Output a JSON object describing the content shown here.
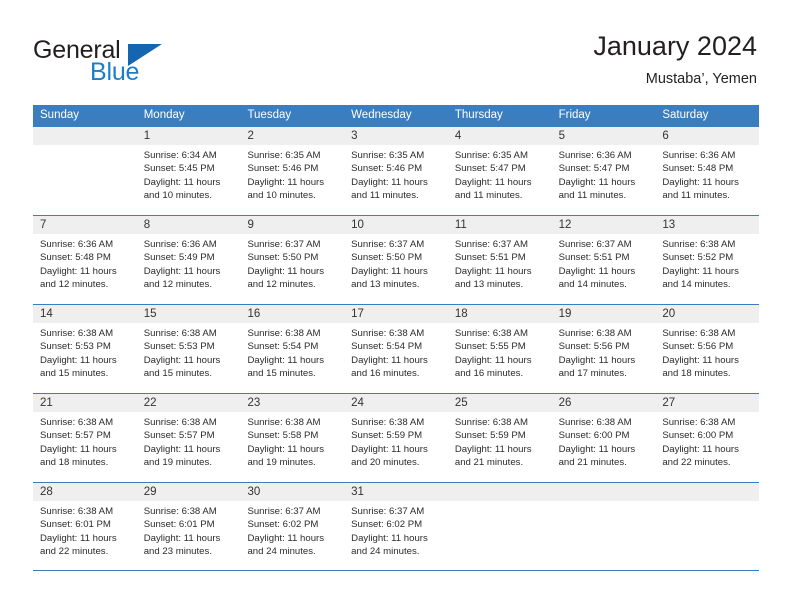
{
  "brand": {
    "name_part1": "General",
    "name_part2": "Blue",
    "triangle_color": "#1566b0",
    "blue_color": "#1a7ec8"
  },
  "header": {
    "title": "January 2024",
    "subtitle": "Mustaba’, Yemen"
  },
  "theme": {
    "header_blue": "#3a7ec0",
    "band_gray": "#efefef",
    "text": "#231f20"
  },
  "weekdays": [
    "Sunday",
    "Monday",
    "Tuesday",
    "Wednesday",
    "Thursday",
    "Friday",
    "Saturday"
  ],
  "weeks": [
    [
      {
        "day": "",
        "sunrise": "",
        "sunset": "",
        "daylight": "",
        "daylight2": ""
      },
      {
        "day": "1",
        "sunrise": "Sunrise: 6:34 AM",
        "sunset": "Sunset: 5:45 PM",
        "daylight": "Daylight: 11 hours",
        "daylight2": "and 10 minutes."
      },
      {
        "day": "2",
        "sunrise": "Sunrise: 6:35 AM",
        "sunset": "Sunset: 5:46 PM",
        "daylight": "Daylight: 11 hours",
        "daylight2": "and 10 minutes."
      },
      {
        "day": "3",
        "sunrise": "Sunrise: 6:35 AM",
        "sunset": "Sunset: 5:46 PM",
        "daylight": "Daylight: 11 hours",
        "daylight2": "and 11 minutes."
      },
      {
        "day": "4",
        "sunrise": "Sunrise: 6:35 AM",
        "sunset": "Sunset: 5:47 PM",
        "daylight": "Daylight: 11 hours",
        "daylight2": "and 11 minutes."
      },
      {
        "day": "5",
        "sunrise": "Sunrise: 6:36 AM",
        "sunset": "Sunset: 5:47 PM",
        "daylight": "Daylight: 11 hours",
        "daylight2": "and 11 minutes."
      },
      {
        "day": "6",
        "sunrise": "Sunrise: 6:36 AM",
        "sunset": "Sunset: 5:48 PM",
        "daylight": "Daylight: 11 hours",
        "daylight2": "and 11 minutes."
      }
    ],
    [
      {
        "day": "7",
        "sunrise": "Sunrise: 6:36 AM",
        "sunset": "Sunset: 5:48 PM",
        "daylight": "Daylight: 11 hours",
        "daylight2": "and 12 minutes."
      },
      {
        "day": "8",
        "sunrise": "Sunrise: 6:36 AM",
        "sunset": "Sunset: 5:49 PM",
        "daylight": "Daylight: 11 hours",
        "daylight2": "and 12 minutes."
      },
      {
        "day": "9",
        "sunrise": "Sunrise: 6:37 AM",
        "sunset": "Sunset: 5:50 PM",
        "daylight": "Daylight: 11 hours",
        "daylight2": "and 12 minutes."
      },
      {
        "day": "10",
        "sunrise": "Sunrise: 6:37 AM",
        "sunset": "Sunset: 5:50 PM",
        "daylight": "Daylight: 11 hours",
        "daylight2": "and 13 minutes."
      },
      {
        "day": "11",
        "sunrise": "Sunrise: 6:37 AM",
        "sunset": "Sunset: 5:51 PM",
        "daylight": "Daylight: 11 hours",
        "daylight2": "and 13 minutes."
      },
      {
        "day": "12",
        "sunrise": "Sunrise: 6:37 AM",
        "sunset": "Sunset: 5:51 PM",
        "daylight": "Daylight: 11 hours",
        "daylight2": "and 14 minutes."
      },
      {
        "day": "13",
        "sunrise": "Sunrise: 6:38 AM",
        "sunset": "Sunset: 5:52 PM",
        "daylight": "Daylight: 11 hours",
        "daylight2": "and 14 minutes."
      }
    ],
    [
      {
        "day": "14",
        "sunrise": "Sunrise: 6:38 AM",
        "sunset": "Sunset: 5:53 PM",
        "daylight": "Daylight: 11 hours",
        "daylight2": "and 15 minutes."
      },
      {
        "day": "15",
        "sunrise": "Sunrise: 6:38 AM",
        "sunset": "Sunset: 5:53 PM",
        "daylight": "Daylight: 11 hours",
        "daylight2": "and 15 minutes."
      },
      {
        "day": "16",
        "sunrise": "Sunrise: 6:38 AM",
        "sunset": "Sunset: 5:54 PM",
        "daylight": "Daylight: 11 hours",
        "daylight2": "and 15 minutes."
      },
      {
        "day": "17",
        "sunrise": "Sunrise: 6:38 AM",
        "sunset": "Sunset: 5:54 PM",
        "daylight": "Daylight: 11 hours",
        "daylight2": "and 16 minutes."
      },
      {
        "day": "18",
        "sunrise": "Sunrise: 6:38 AM",
        "sunset": "Sunset: 5:55 PM",
        "daylight": "Daylight: 11 hours",
        "daylight2": "and 16 minutes."
      },
      {
        "day": "19",
        "sunrise": "Sunrise: 6:38 AM",
        "sunset": "Sunset: 5:56 PM",
        "daylight": "Daylight: 11 hours",
        "daylight2": "and 17 minutes."
      },
      {
        "day": "20",
        "sunrise": "Sunrise: 6:38 AM",
        "sunset": "Sunset: 5:56 PM",
        "daylight": "Daylight: 11 hours",
        "daylight2": "and 18 minutes."
      }
    ],
    [
      {
        "day": "21",
        "sunrise": "Sunrise: 6:38 AM",
        "sunset": "Sunset: 5:57 PM",
        "daylight": "Daylight: 11 hours",
        "daylight2": "and 18 minutes."
      },
      {
        "day": "22",
        "sunrise": "Sunrise: 6:38 AM",
        "sunset": "Sunset: 5:57 PM",
        "daylight": "Daylight: 11 hours",
        "daylight2": "and 19 minutes."
      },
      {
        "day": "23",
        "sunrise": "Sunrise: 6:38 AM",
        "sunset": "Sunset: 5:58 PM",
        "daylight": "Daylight: 11 hours",
        "daylight2": "and 19 minutes."
      },
      {
        "day": "24",
        "sunrise": "Sunrise: 6:38 AM",
        "sunset": "Sunset: 5:59 PM",
        "daylight": "Daylight: 11 hours",
        "daylight2": "and 20 minutes."
      },
      {
        "day": "25",
        "sunrise": "Sunrise: 6:38 AM",
        "sunset": "Sunset: 5:59 PM",
        "daylight": "Daylight: 11 hours",
        "daylight2": "and 21 minutes."
      },
      {
        "day": "26",
        "sunrise": "Sunrise: 6:38 AM",
        "sunset": "Sunset: 6:00 PM",
        "daylight": "Daylight: 11 hours",
        "daylight2": "and 21 minutes."
      },
      {
        "day": "27",
        "sunrise": "Sunrise: 6:38 AM",
        "sunset": "Sunset: 6:00 PM",
        "daylight": "Daylight: 11 hours",
        "daylight2": "and 22 minutes."
      }
    ],
    [
      {
        "day": "28",
        "sunrise": "Sunrise: 6:38 AM",
        "sunset": "Sunset: 6:01 PM",
        "daylight": "Daylight: 11 hours",
        "daylight2": "and 22 minutes."
      },
      {
        "day": "29",
        "sunrise": "Sunrise: 6:38 AM",
        "sunset": "Sunset: 6:01 PM",
        "daylight": "Daylight: 11 hours",
        "daylight2": "and 23 minutes."
      },
      {
        "day": "30",
        "sunrise": "Sunrise: 6:37 AM",
        "sunset": "Sunset: 6:02 PM",
        "daylight": "Daylight: 11 hours",
        "daylight2": "and 24 minutes."
      },
      {
        "day": "31",
        "sunrise": "Sunrise: 6:37 AM",
        "sunset": "Sunset: 6:02 PM",
        "daylight": "Daylight: 11 hours",
        "daylight2": "and 24 minutes."
      },
      {
        "day": "",
        "sunrise": "",
        "sunset": "",
        "daylight": "",
        "daylight2": ""
      },
      {
        "day": "",
        "sunrise": "",
        "sunset": "",
        "daylight": "",
        "daylight2": ""
      },
      {
        "day": "",
        "sunrise": "",
        "sunset": "",
        "daylight": "",
        "daylight2": ""
      }
    ]
  ]
}
